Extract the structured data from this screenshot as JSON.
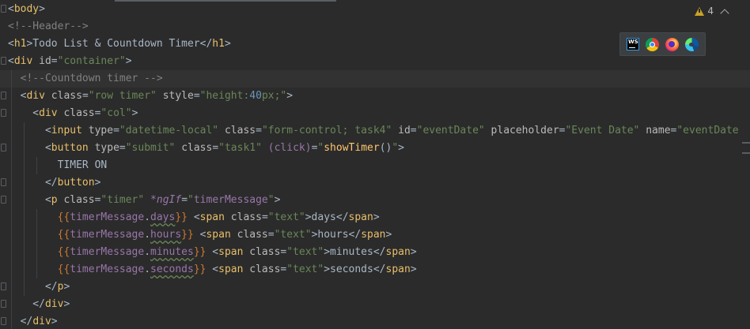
{
  "editor": {
    "warning_count": "4",
    "line_tokens": [
      [
        [
          "t-text",
          "<"
        ],
        [
          "t-tag",
          "body"
        ],
        [
          "t-text",
          ">"
        ]
      ],
      [
        [
          "t-comment",
          "<!--Header-->"
        ]
      ],
      [
        [
          "t-text",
          "<"
        ],
        [
          "t-tag",
          "h1"
        ],
        [
          "t-text",
          ">Todo List & Countdown Timer</"
        ],
        [
          "t-tag",
          "h1"
        ],
        [
          "t-text",
          ">"
        ]
      ],
      [
        [
          "t-text",
          "<"
        ],
        [
          "t-tag",
          "div"
        ],
        [
          "t-text",
          " "
        ],
        [
          "t-attr",
          "id"
        ],
        [
          "t-text",
          "="
        ],
        [
          "t-str",
          "\"container\""
        ],
        [
          "t-text",
          ">"
        ]
      ],
      [
        [
          "t-comment",
          "  <!--Countdown timer -->"
        ]
      ],
      [
        [
          "t-text",
          "  <"
        ],
        [
          "t-tag",
          "div"
        ],
        [
          "t-text",
          " "
        ],
        [
          "t-attr",
          "class"
        ],
        [
          "t-text",
          "="
        ],
        [
          "t-str",
          "\"row timer\""
        ],
        [
          "t-text",
          " "
        ],
        [
          "t-attr",
          "style"
        ],
        [
          "t-text",
          "="
        ],
        [
          "t-str",
          "\"height:"
        ],
        [
          "t-num",
          "40"
        ],
        [
          "t-str",
          "px;\""
        ],
        [
          "t-text",
          ">"
        ]
      ],
      [
        [
          "t-text",
          "    <"
        ],
        [
          "t-tag",
          "div"
        ],
        [
          "t-text",
          " "
        ],
        [
          "t-attr",
          "class"
        ],
        [
          "t-text",
          "="
        ],
        [
          "t-str",
          "\"col\""
        ],
        [
          "t-text",
          ">"
        ]
      ],
      [
        [
          "t-text",
          "      <"
        ],
        [
          "t-tag",
          "input"
        ],
        [
          "t-text",
          " "
        ],
        [
          "t-attr",
          "type"
        ],
        [
          "t-text",
          "="
        ],
        [
          "t-str",
          "\"datetime-local\""
        ],
        [
          "t-text",
          " "
        ],
        [
          "t-attr",
          "class"
        ],
        [
          "t-text",
          "="
        ],
        [
          "t-str",
          "\"form-control; task4\""
        ],
        [
          "t-text",
          " "
        ],
        [
          "t-attr",
          "id"
        ],
        [
          "t-text",
          "="
        ],
        [
          "t-str",
          "\"eventDate\""
        ],
        [
          "t-text",
          " "
        ],
        [
          "t-attr",
          "placeholder"
        ],
        [
          "t-text",
          "="
        ],
        [
          "t-str",
          "\"Event Date\""
        ],
        [
          "t-text",
          " "
        ],
        [
          "t-attr",
          "name"
        ],
        [
          "t-text",
          "="
        ],
        [
          "t-str",
          "\"eventDate"
        ]
      ],
      [
        [
          "t-text",
          "      <"
        ],
        [
          "t-tag",
          "button"
        ],
        [
          "t-text",
          " "
        ],
        [
          "t-attr",
          "type"
        ],
        [
          "t-text",
          "="
        ],
        [
          "t-str",
          "\"submit\""
        ],
        [
          "t-text",
          " "
        ],
        [
          "t-attr",
          "class"
        ],
        [
          "t-text",
          "="
        ],
        [
          "t-str",
          "\"task1\""
        ],
        [
          "t-text",
          " "
        ],
        [
          "t-dim",
          "(click)"
        ],
        [
          "t-text",
          "="
        ],
        [
          "t-str",
          "\""
        ],
        [
          "t-fn",
          "showTimer"
        ],
        [
          "t-text",
          "()"
        ],
        [
          "t-str",
          "\""
        ],
        [
          "t-text",
          ">"
        ]
      ],
      [
        [
          "t-text",
          "        TIMER ON"
        ]
      ],
      [
        [
          "t-text",
          "      </"
        ],
        [
          "t-tag",
          "button"
        ],
        [
          "t-text",
          ">"
        ]
      ],
      [
        [
          "t-text",
          "      <"
        ],
        [
          "t-tag",
          "p"
        ],
        [
          "t-text",
          " "
        ],
        [
          "t-attr",
          "class"
        ],
        [
          "t-text",
          "="
        ],
        [
          "t-str",
          "\"timer\""
        ],
        [
          "t-text",
          " "
        ],
        [
          "t-ital",
          "*ngIf"
        ],
        [
          "t-text",
          "="
        ],
        [
          "t-str",
          "\""
        ],
        [
          "t-dim",
          "timerMessage"
        ],
        [
          "t-str",
          "\""
        ],
        [
          "t-text",
          ">"
        ]
      ],
      [
        [
          "t-text",
          "        "
        ],
        [
          "t-brace",
          "{{"
        ],
        [
          "t-dim",
          "timerMessage"
        ],
        [
          "t-text",
          "."
        ],
        [
          "t-dim t-under",
          "days"
        ],
        [
          "t-brace",
          "}}"
        ],
        [
          "t-text",
          " <"
        ],
        [
          "t-tag",
          "span"
        ],
        [
          "t-text",
          " "
        ],
        [
          "t-attr",
          "class"
        ],
        [
          "t-text",
          "="
        ],
        [
          "t-str",
          "\"text\""
        ],
        [
          "t-text",
          ">days</"
        ],
        [
          "t-tag",
          "span"
        ],
        [
          "t-text",
          ">"
        ]
      ],
      [
        [
          "t-text",
          "        "
        ],
        [
          "t-brace",
          "{{"
        ],
        [
          "t-dim",
          "timerMessage"
        ],
        [
          "t-text",
          "."
        ],
        [
          "t-dim t-under",
          "hours"
        ],
        [
          "t-brace",
          "}}"
        ],
        [
          "t-text",
          " <"
        ],
        [
          "t-tag",
          "span"
        ],
        [
          "t-text",
          " "
        ],
        [
          "t-attr",
          "class"
        ],
        [
          "t-text",
          "="
        ],
        [
          "t-str",
          "\"text\""
        ],
        [
          "t-text",
          ">hours</"
        ],
        [
          "t-tag",
          "span"
        ],
        [
          "t-text",
          ">"
        ]
      ],
      [
        [
          "t-text",
          "        "
        ],
        [
          "t-brace",
          "{{"
        ],
        [
          "t-dim",
          "timerMessage"
        ],
        [
          "t-text",
          "."
        ],
        [
          "t-dim t-under",
          "minutes"
        ],
        [
          "t-brace",
          "}}"
        ],
        [
          "t-text",
          " <"
        ],
        [
          "t-tag",
          "span"
        ],
        [
          "t-text",
          " "
        ],
        [
          "t-attr",
          "class"
        ],
        [
          "t-text",
          "="
        ],
        [
          "t-str",
          "\"text\""
        ],
        [
          "t-text",
          ">minutes</"
        ],
        [
          "t-tag",
          "span"
        ],
        [
          "t-text",
          ">"
        ]
      ],
      [
        [
          "t-text",
          "        "
        ],
        [
          "t-brace",
          "{{"
        ],
        [
          "t-dim",
          "timerMessage"
        ],
        [
          "t-text",
          "."
        ],
        [
          "t-dim t-under",
          "seconds"
        ],
        [
          "t-brace",
          "}}"
        ],
        [
          "t-text",
          " <"
        ],
        [
          "t-tag",
          "span"
        ],
        [
          "t-text",
          " "
        ],
        [
          "t-attr",
          "class"
        ],
        [
          "t-text",
          "="
        ],
        [
          "t-str",
          "\"text\""
        ],
        [
          "t-text",
          ">seconds</"
        ],
        [
          "t-tag",
          "span"
        ],
        [
          "t-text",
          ">"
        ]
      ],
      [
        [
          "t-text",
          "      </"
        ],
        [
          "t-tag",
          "p"
        ],
        [
          "t-text",
          ">"
        ]
      ],
      [
        [
          "t-text",
          "    </"
        ],
        [
          "t-tag",
          "div"
        ],
        [
          "t-text",
          ">"
        ]
      ],
      [
        [
          "t-text",
          "  </"
        ],
        [
          "t-tag",
          "div"
        ],
        [
          "t-text",
          ">"
        ]
      ]
    ]
  },
  "browser_icons": [
    {
      "name": "webstorm-icon",
      "label": "WS"
    },
    {
      "name": "chrome-icon"
    },
    {
      "name": "firefox-icon"
    },
    {
      "name": "edge-icon"
    }
  ]
}
